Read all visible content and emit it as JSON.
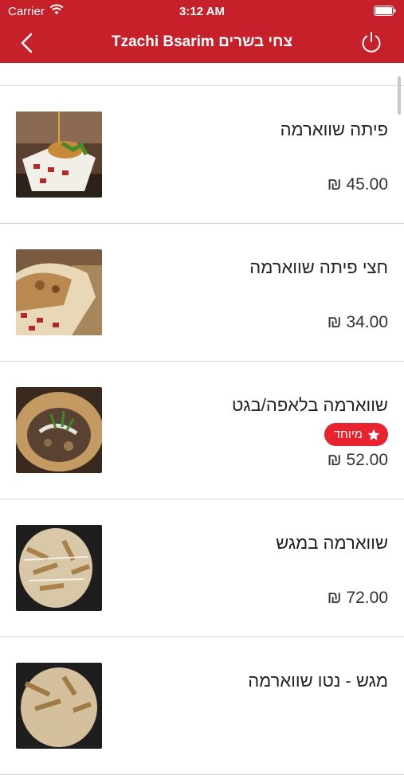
{
  "status_bar": {
    "carrier": "Carrier",
    "time": "3:12 AM"
  },
  "nav": {
    "title": "Tzachi Bsarim צחי בשרים",
    "back_icon": "chevron-left-icon",
    "power_icon": "power-icon"
  },
  "colors": {
    "header_bg": "#c6202a",
    "badge_bg": "#e8232f"
  },
  "items": [
    {
      "name": "פיתה שווארמה",
      "price": "₪ 45.00"
    },
    {
      "name": "חצי פיתה שווארמה",
      "price": "₪ 34.00"
    },
    {
      "name": "שווארמה בלאפה/בגט",
      "price": "₪ 52.00",
      "badge": "מיוחד"
    },
    {
      "name": "שווארמה במגש",
      "price": "₪ 72.00"
    },
    {
      "name": "מגש - נטו שווארמה",
      "price": ""
    }
  ]
}
